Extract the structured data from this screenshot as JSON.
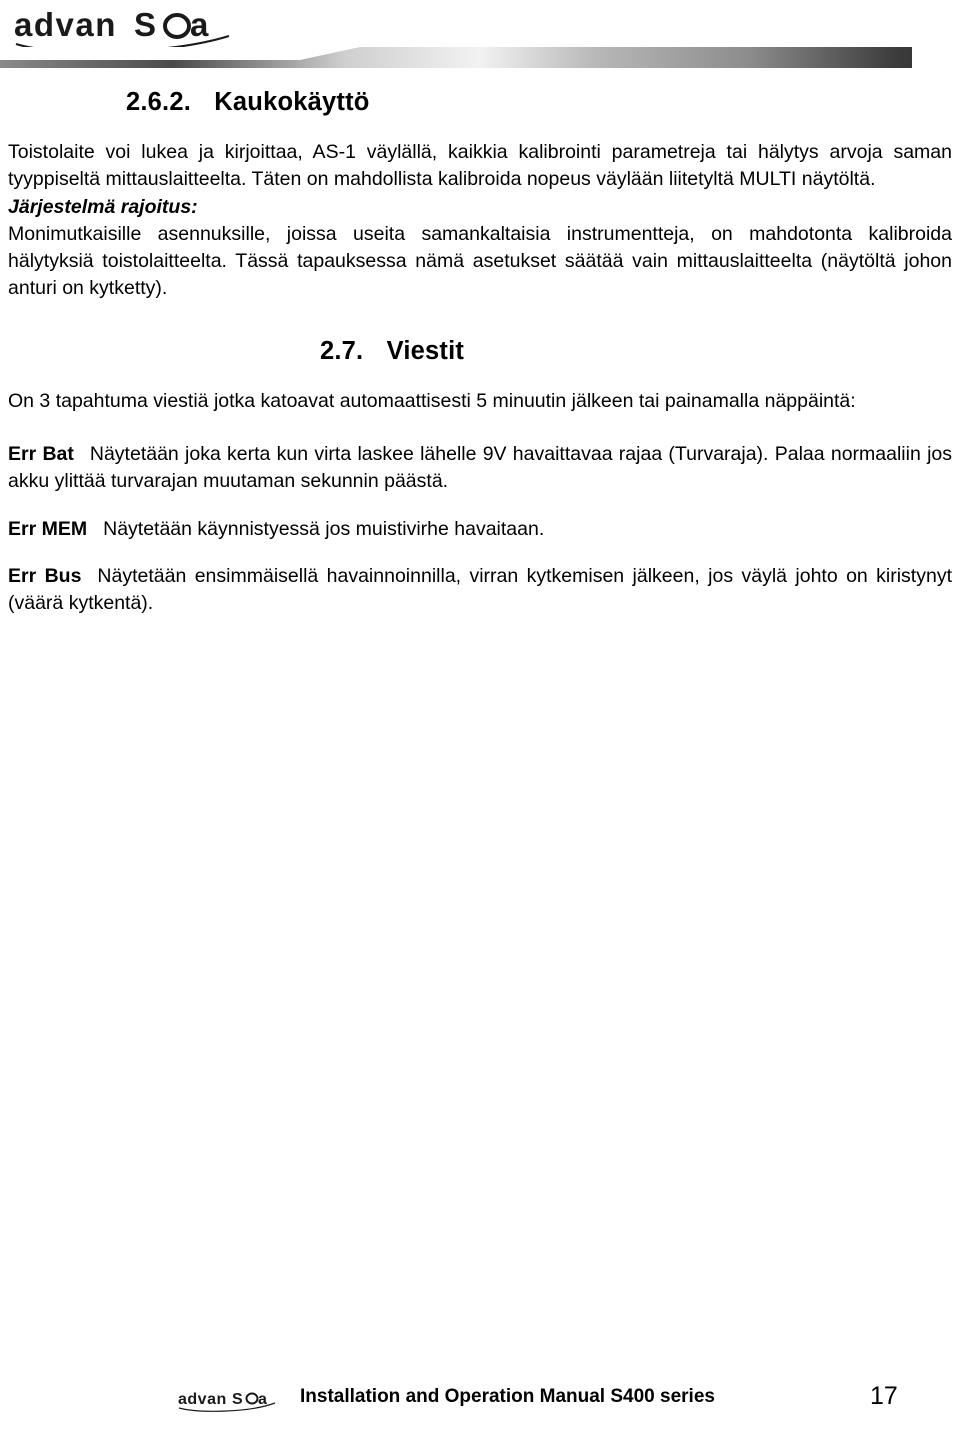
{
  "header": {
    "logo_text": "advanSea",
    "logo_alt": "advansea-logo"
  },
  "sections": [
    {
      "number": "2.6.2.",
      "title": "Kaukokäyttö",
      "paragraphs": [
        "Toistolaite voi lukea ja kirjoittaa, AS-1 väylällä, kaikkia kalibrointi parametreja tai hälytys arvoja saman tyyppiseltä mittauslaitteelta.   Täten on mahdollista kalibroida nopeus väylään liitetyltä MULTI näytöltä."
      ],
      "subheading": "Järjestelmä rajoitus:",
      "subparagraphs": [
        "Monimutkaisille asennuksille, joissa useita samankaltaisia instrumentteja, on mahdotonta kalibroida hälytyksiä toistolaitteelta. Tässä tapauksessa nämä asetukset säätää vain mittauslaitteelta (näytöltä johon anturi on kytketty)."
      ]
    },
    {
      "number": "2.7.",
      "title": "Viestit",
      "intro": "On 3 tapahtuma viestiä jotka katoavat automaattisesti 5 minuutin jälkeen tai painamalla näppäintä:",
      "messages": [
        {
          "term": "Err Bat",
          "text": "Näytetään joka kerta kun virta laskee lähelle 9V havaittavaa rajaa (Turvaraja). Palaa normaaliin jos akku ylittää turvarajan muutaman sekunnin päästä."
        },
        {
          "term": "Err MEM",
          "text": "Näytetään käynnistyessä jos muistivirhe havaitaan."
        },
        {
          "term": "Err Bus",
          "text": "Näytetään ensimmäisellä havainnoinnilla, virran kytkemisen jälkeen, jos väylä johto on kiristynyt (väärä kytkentä)."
        }
      ]
    }
  ],
  "footer": {
    "logo_text": "advanSea",
    "title": "Installation and Operation Manual S400 series",
    "page_number": "17"
  }
}
